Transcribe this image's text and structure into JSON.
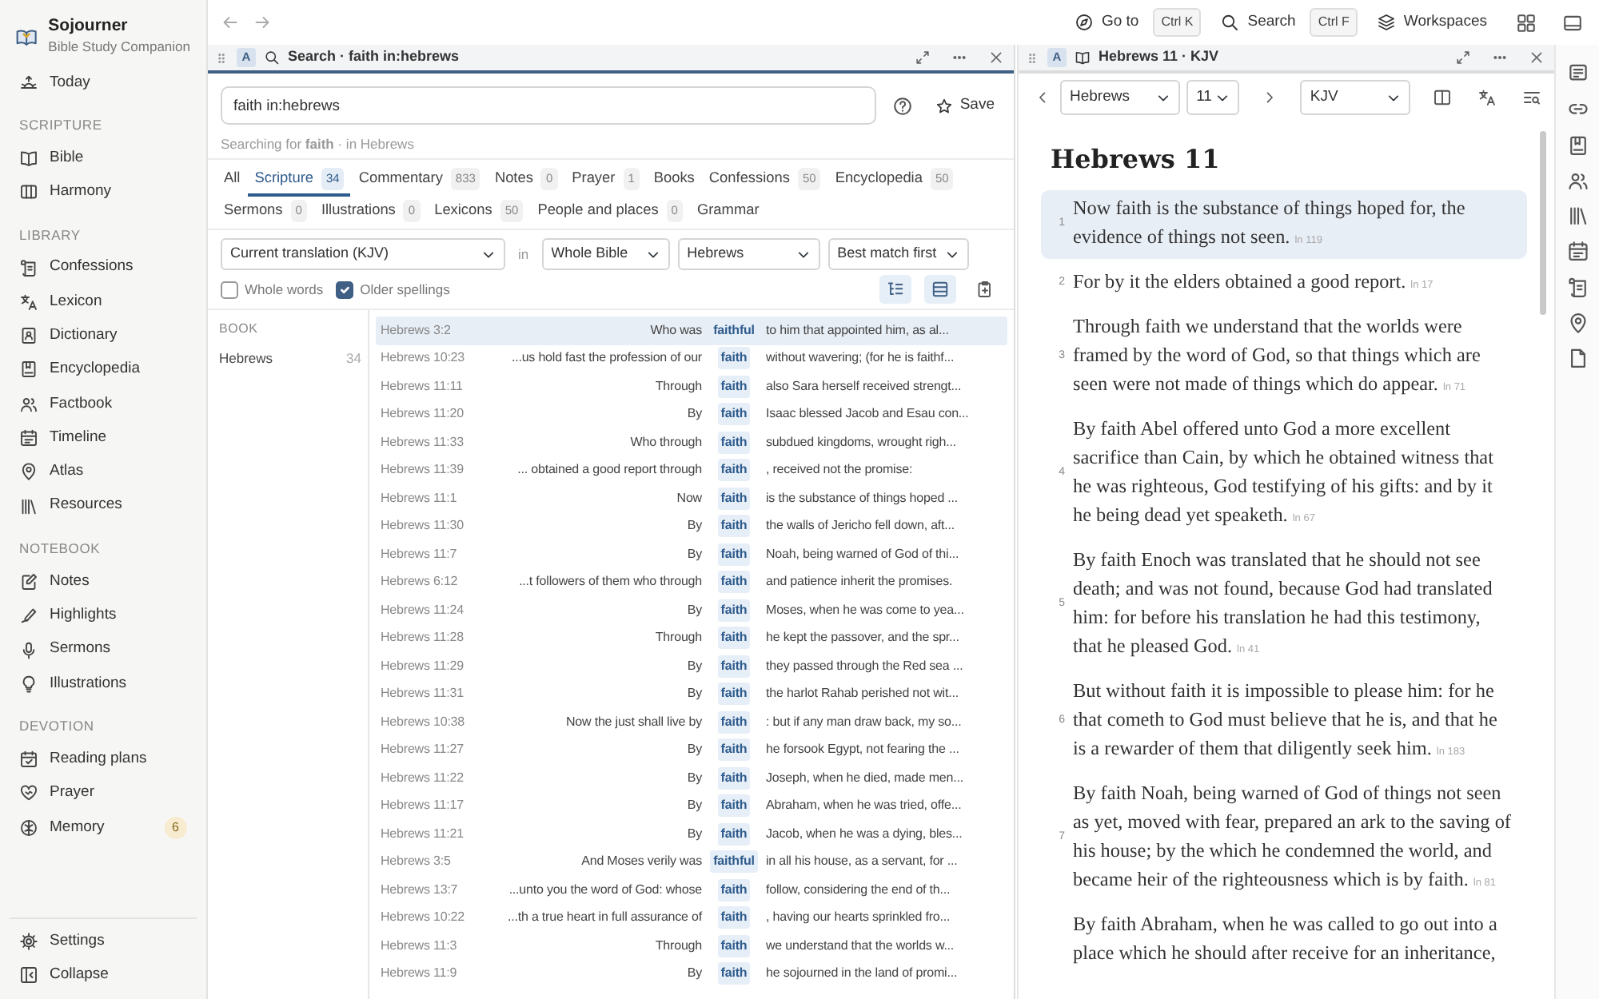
{
  "app": {
    "name": "Sojourner",
    "tagline": "Bible Study Companion"
  },
  "sidebar": {
    "top_items": [
      {
        "label": "Today"
      }
    ],
    "sections": [
      {
        "title": "SCRIPTURE",
        "items": [
          {
            "label": "Bible"
          },
          {
            "label": "Harmony"
          }
        ]
      },
      {
        "title": "LIBRARY",
        "items": [
          {
            "label": "Confessions"
          },
          {
            "label": "Lexicon"
          },
          {
            "label": "Dictionary"
          },
          {
            "label": "Encyclopedia"
          },
          {
            "label": "Factbook"
          },
          {
            "label": "Timeline"
          },
          {
            "label": "Atlas"
          },
          {
            "label": "Resources"
          }
        ]
      },
      {
        "title": "NOTEBOOK",
        "items": [
          {
            "label": "Notes"
          },
          {
            "label": "Highlights"
          },
          {
            "label": "Sermons"
          },
          {
            "label": "Illustrations"
          }
        ]
      },
      {
        "title": "DEVOTION",
        "items": [
          {
            "label": "Reading plans"
          },
          {
            "label": "Prayer"
          },
          {
            "label": "Memory",
            "badge": "6"
          }
        ]
      }
    ],
    "bottom_items": [
      {
        "label": "Settings"
      },
      {
        "label": "Collapse"
      }
    ]
  },
  "toolbar": {
    "goto": {
      "label": "Go to",
      "shortcut": "Ctrl K"
    },
    "search": {
      "label": "Search",
      "shortcut": "Ctrl F"
    },
    "workspaces": {
      "label": "Workspaces"
    }
  },
  "search_panel": {
    "badge": "A",
    "title": "Search · faith in:hebrews",
    "active": true,
    "query": "faith in:hebrews",
    "save_label": "Save",
    "summary": "Searching for **faith** · in Hebrews",
    "tab_rows": [
      [
        {
          "label": "All",
          "selected": false
        },
        {
          "label": "Scripture",
          "count": "34",
          "selected": true
        },
        {
          "label": "Commentary",
          "count": "833",
          "selected": false
        },
        {
          "label": "Notes",
          "count": "0",
          "selected": false
        },
        {
          "label": "Prayer",
          "count": "1",
          "selected": false
        },
        {
          "label": "Books",
          "selected": false
        },
        {
          "label": "Confessions",
          "count": "50",
          "selected": false
        },
        {
          "label": "Encyclopedia",
          "count": "50",
          "selected": false
        }
      ],
      [
        {
          "label": "Sermons",
          "count": "0",
          "selected": false
        },
        {
          "label": "Illustrations",
          "count": "0",
          "selected": false
        },
        {
          "label": "Lexicons",
          "count": "50",
          "selected": false
        },
        {
          "label": "People and places",
          "count": "0",
          "selected": false
        },
        {
          "label": "Grammar",
          "selected": false
        }
      ]
    ],
    "filters": {
      "translation": "Current translation (KJV)",
      "in_label": "in",
      "scope": "Whole Bible",
      "book": "Hebrews",
      "sort": "Best match first"
    },
    "options": [
      {
        "label": "Whole words",
        "checked": false
      },
      {
        "label": "Older spellings",
        "checked": true
      }
    ],
    "facets": {
      "heading": "BOOK",
      "items": [
        {
          "label": "Hebrews",
          "count": "34"
        }
      ]
    },
    "results": [
      {
        "ref": "Hebrews 3:2",
        "before": "Who was",
        "match": "faithful",
        "after": "to him that appointed him, as al...",
        "selected": true
      },
      {
        "ref": "Hebrews 10:23",
        "before": "...us hold fast the profession of our",
        "match": "faith",
        "after": "without wavering; (for he is faithf...",
        "selected": false
      },
      {
        "ref": "Hebrews 11:11",
        "before": "Through",
        "match": "faith",
        "after": "also Sara herself received strengt...",
        "selected": false
      },
      {
        "ref": "Hebrews 11:20",
        "before": "By",
        "match": "faith",
        "after": "Isaac blessed Jacob and Esau con...",
        "selected": false
      },
      {
        "ref": "Hebrews 11:33",
        "before": "Who through",
        "match": "faith",
        "after": "subdued kingdoms, wrought righ...",
        "selected": false
      },
      {
        "ref": "Hebrews 11:39",
        "before": "... obtained a good report through",
        "match": "faith",
        "after": ", received not the promise:",
        "selected": false
      },
      {
        "ref": "Hebrews 11:1",
        "before": "Now",
        "match": "faith",
        "after": "is the substance of things hoped ...",
        "selected": false
      },
      {
        "ref": "Hebrews 11:30",
        "before": "By",
        "match": "faith",
        "after": "the walls of Jericho fell down, aft...",
        "selected": false
      },
      {
        "ref": "Hebrews 11:7",
        "before": "By",
        "match": "faith",
        "after": "Noah, being warned of God of thi...",
        "selected": false
      },
      {
        "ref": "Hebrews 6:12",
        "before": "...t followers of them who through",
        "match": "faith",
        "after": "and patience inherit the promises.",
        "selected": false
      },
      {
        "ref": "Hebrews 11:24",
        "before": "By",
        "match": "faith",
        "after": "Moses, when he was come to yea...",
        "selected": false
      },
      {
        "ref": "Hebrews 11:28",
        "before": "Through",
        "match": "faith",
        "after": "he kept the passover, and the spr...",
        "selected": false
      },
      {
        "ref": "Hebrews 11:29",
        "before": "By",
        "match": "faith",
        "after": "they passed through the Red sea ...",
        "selected": false
      },
      {
        "ref": "Hebrews 11:31",
        "before": "By",
        "match": "faith",
        "after": "the harlot Rahab perished not wit...",
        "selected": false
      },
      {
        "ref": "Hebrews 10:38",
        "before": "Now the just shall live by",
        "match": "faith",
        "after": ": but if any man draw back, my so...",
        "selected": false
      },
      {
        "ref": "Hebrews 11:27",
        "before": "By",
        "match": "faith",
        "after": "he forsook Egypt, not fearing the ...",
        "selected": false
      },
      {
        "ref": "Hebrews 11:22",
        "before": "By",
        "match": "faith",
        "after": "Joseph, when he died, made men...",
        "selected": false
      },
      {
        "ref": "Hebrews 11:17",
        "before": "By",
        "match": "faith",
        "after": "Abraham, when he was tried, offe...",
        "selected": false
      },
      {
        "ref": "Hebrews 11:21",
        "before": "By",
        "match": "faith",
        "after": "Jacob, when he was a dying, bles...",
        "selected": false
      },
      {
        "ref": "Hebrews 3:5",
        "before": "And Moses verily was",
        "match": "faithful",
        "after": "in all his house, as a servant, for ...",
        "selected": false
      },
      {
        "ref": "Hebrews 13:7",
        "before": "...unto you the word of God: whose",
        "match": "faith",
        "after": "follow, considering the end of th...",
        "selected": false
      },
      {
        "ref": "Hebrews 10:22",
        "before": "...th a true heart in full assurance of",
        "match": "faith",
        "after": ", having our hearts sprinkled fro...",
        "selected": false
      },
      {
        "ref": "Hebrews 11:3",
        "before": "Through",
        "match": "faith",
        "after": "we understand that the worlds w...",
        "selected": false
      },
      {
        "ref": "Hebrews 11:9",
        "before": "By",
        "match": "faith",
        "after": "he sojourned in the land of promi...",
        "selected": false
      }
    ]
  },
  "reader": {
    "badge": "A",
    "title": "Hebrews 11 · KJV",
    "active": false,
    "book": "Hebrews",
    "chapter": "11",
    "translation": "KJV",
    "heading": "Hebrews 11",
    "verses": [
      {
        "number": "1",
        "text": "Now faith is the substance of things hoped for, the evidence of things not seen.",
        "links": "ln 119",
        "selected": true
      },
      {
        "number": "2",
        "text": "For by it the elders obtained a good report.",
        "links": "ln 17",
        "selected": false
      },
      {
        "number": "3",
        "text": "Through faith we understand that the worlds were framed by the word of God, so that things which are seen were not made of things which do appear.",
        "links": "ln 71",
        "selected": false
      },
      {
        "number": "4",
        "text": "By faith Abel offered unto God a more excellent sacrifice than Cain, by which he obtained witness that he was righteous, God testifying of his gifts: and by it he being dead yet speaketh.",
        "links": "ln 67",
        "selected": false
      },
      {
        "number": "5",
        "text": "By faith Enoch was translated that he should not see death; and was not found, because God had translated him: for before his translation he had this testimony, that he pleased God.",
        "links": "ln 41",
        "selected": false
      },
      {
        "number": "6",
        "text": "But without faith it is impossible to please him: for he that cometh to God must believe that he is, and that he is a rewarder of them that diligently seek him.",
        "links": "ln 183",
        "selected": false
      },
      {
        "number": "7",
        "text": "By faith Noah, being warned of God of things not seen as yet, moved with fear, prepared an ark to the saving of his house; by the which he condemned the world, and became heir of the righteousness which is by faith.",
        "links": "ln 81",
        "selected": false
      },
      {
        "text": "By faith Abraham, when he was called to go out into a place which he should after receive for an inheritance,",
        "selected": false
      }
    ]
  }
}
